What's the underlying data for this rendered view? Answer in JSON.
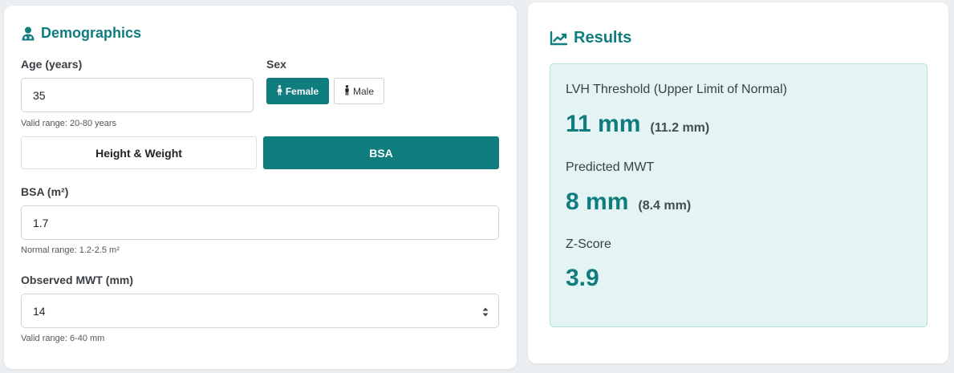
{
  "demographics": {
    "title": "Demographics",
    "age_label": "Age (years)",
    "age_value": "35",
    "age_hint": "Valid range: 20-80 years",
    "sex_label": "Sex",
    "female_label": "Female",
    "male_label": "Male",
    "selected_sex": "Female",
    "toggle_hw_label": "Height & Weight",
    "toggle_bsa_label": "BSA",
    "selected_mode": "BSA",
    "bsa_label": "BSA (m²)",
    "bsa_value": "1.7",
    "bsa_hint": "Normal range: 1.2-2.5 m²",
    "mwt_label": "Observed MWT (mm)",
    "mwt_value": "14",
    "mwt_hint": "Valid range: 6-40 mm"
  },
  "results": {
    "title": "Results",
    "lvh_label": "LVH Threshold (Upper Limit of Normal)",
    "lvh_value": "11 mm",
    "lvh_precise": "(11.2 mm)",
    "pred_label": "Predicted MWT",
    "pred_value": "8 mm",
    "pred_precise": "(8.4 mm)",
    "z_label": "Z-Score",
    "z_value": "3.9"
  },
  "colors": {
    "accent": "#0f7c7d",
    "results_bg": "#e4f3f3",
    "page_bg": "#eceff1"
  },
  "icons": {
    "demographics": "user-doctor-icon",
    "results": "chart-line-icon",
    "female": "female-person-icon",
    "male": "male-person-icon"
  }
}
